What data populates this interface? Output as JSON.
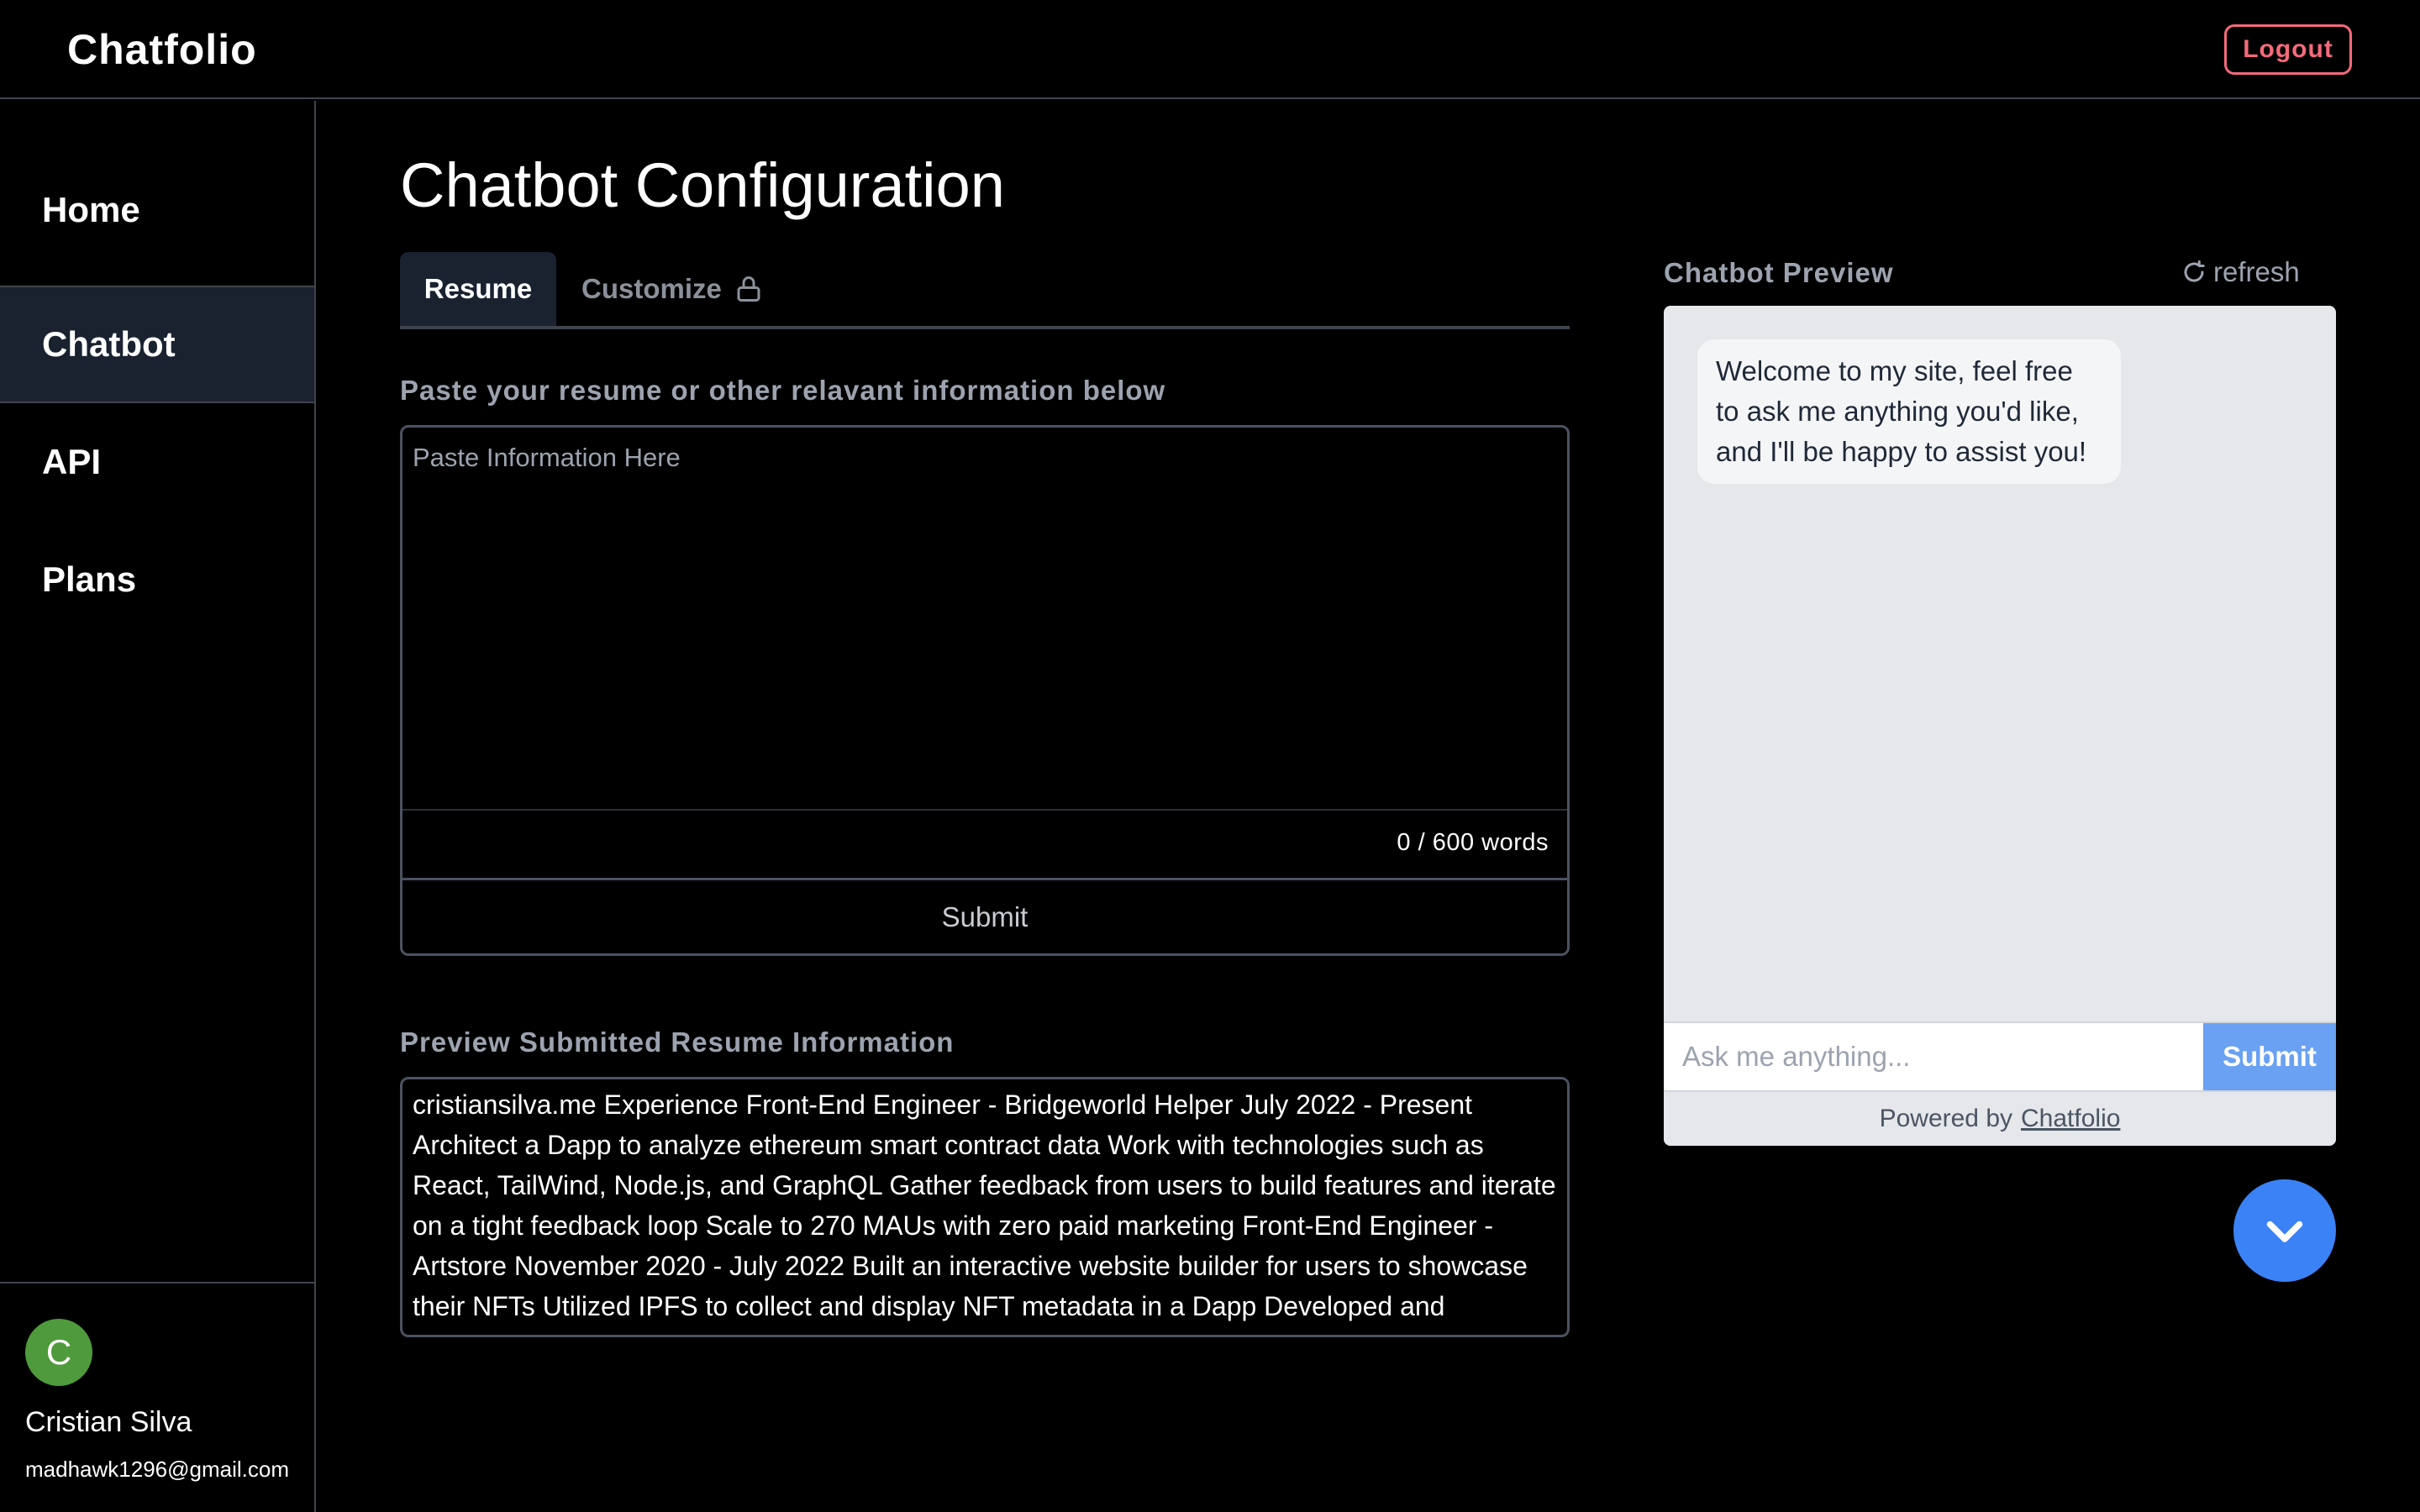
{
  "app": {
    "brand": "Chatfolio",
    "logout_label": "Logout"
  },
  "sidebar": {
    "items": [
      {
        "label": "Home"
      },
      {
        "label": "Chatbot"
      },
      {
        "label": "API"
      },
      {
        "label": "Plans"
      }
    ],
    "active_item": "Chatbot",
    "user": {
      "initial": "C",
      "name": "Cristian Silva",
      "email": "madhawk1296@gmail.com"
    }
  },
  "main": {
    "title": "Chatbot Configuration",
    "tabs": [
      {
        "label": "Resume",
        "icon": ""
      },
      {
        "label": "Customize",
        "icon": "lock-icon"
      }
    ],
    "resume": {
      "label": "Paste your resume or other relavant information below",
      "placeholder": "Paste Information Here",
      "value": "",
      "word_count": "0 / 600 words",
      "submit_label": "Submit"
    },
    "preview": {
      "label": "Preview Submitted Resume Information",
      "text": "cristiansilva.me Experience Front-End Engineer - Bridgeworld Helper July 2022 - Present Architect a Dapp to analyze ethereum smart contract data Work with technologies such as React, TailWind, Node.js, and GraphQL Gather feedback from users to build features and iterate on a tight feedback loop Scale to 270 MAUs with zero paid marketing Front-End Engineer - Artstore November 2020 - July 2022 Built an interactive website builder for users to showcase their NFTs Utilized IPFS to collect and display NFT metadata in a Dapp Developed and maintained features with Typescript, Next.JS, Redux, and CSS Integrated"
    }
  },
  "chatbot": {
    "label": "Chatbot Preview",
    "refresh_label": "refresh",
    "welcome_message": "Welcome to my site, feel free to ask me anything you'd like, and I'll be happy to assist you!",
    "input_placeholder": "Ask me anything...",
    "submit_label": "Submit",
    "powered_prefix": "Powered by",
    "powered_link": "Chatfolio"
  },
  "colors": {
    "background": "#000000",
    "accent_blue": "#3b82f6",
    "logout_red": "#f56a7b",
    "active_nav": "#1a2230",
    "avatar_green": "#4f9a3c"
  }
}
